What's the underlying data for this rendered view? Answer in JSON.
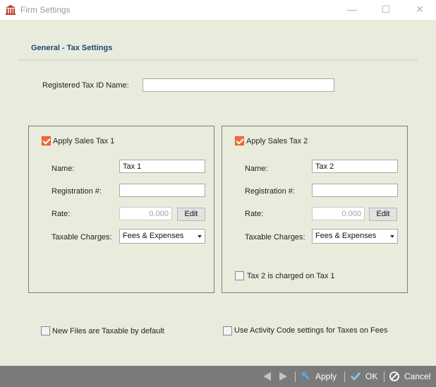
{
  "window": {
    "title": "Firm Settings",
    "minimize_glyph": "—",
    "maximize_glyph": "☐",
    "close_glyph": "✕"
  },
  "section": {
    "title": "General -  Tax Settings"
  },
  "registered_tax_id": {
    "label": "Registered Tax ID Name:",
    "value": ""
  },
  "tax1": {
    "apply_label": "Apply Sales Tax 1",
    "apply_checked": true,
    "name_label": "Name:",
    "name_value": "Tax 1",
    "registration_label": "Registration #:",
    "registration_value": "",
    "rate_label": "Rate:",
    "rate_value": "0.000",
    "edit_label": "Edit",
    "taxable_label": "Taxable Charges:",
    "taxable_value": "Fees & Expenses"
  },
  "tax2": {
    "apply_label": "Apply Sales Tax 2",
    "apply_checked": true,
    "name_label": "Name:",
    "name_value": "Tax 2",
    "registration_label": "Registration #:",
    "registration_value": "",
    "rate_label": "Rate:",
    "rate_value": "0.000",
    "edit_label": "Edit",
    "taxable_label": "Taxable Charges:",
    "taxable_value": "Fees & Expenses",
    "charged_on_tax1_label": "Tax 2 is charged on Tax 1",
    "charged_on_tax1_checked": false
  },
  "options": {
    "new_files_taxable_label": "New Files are Taxable by default",
    "new_files_taxable_checked": false,
    "activity_code_label": "Use Activity Code settings for Taxes on Fees",
    "activity_code_checked": false
  },
  "footer": {
    "apply_label": "Apply",
    "ok_label": "OK",
    "cancel_label": "Cancel"
  },
  "colors": {
    "accent_checkbox": "#f26a3c",
    "section_title": "#24427a",
    "footer_bg": "#7a7a7a",
    "body_bg": "#e9ecdd"
  }
}
